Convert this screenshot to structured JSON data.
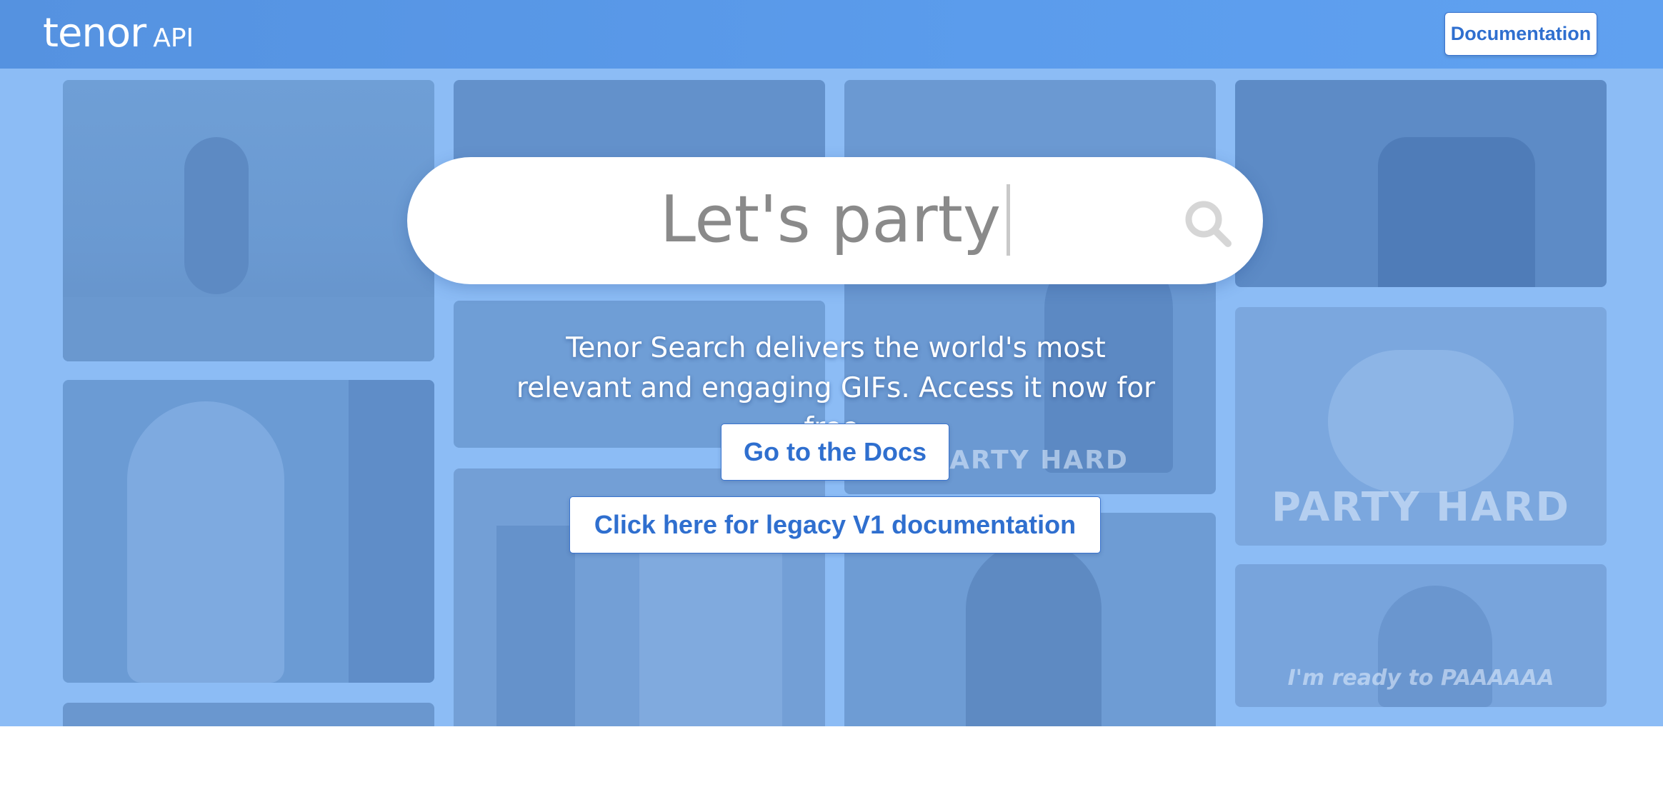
{
  "header": {
    "logo_word": "tenor",
    "logo_api": "API",
    "documentation_label": "Documentation"
  },
  "search": {
    "value": "Let's party"
  },
  "tagline": "Tenor Search delivers the world's most relevant and engaging GIFs. Access it now for free.",
  "buttons": {
    "docs_label": "Go to the Docs",
    "legacy_label": "Click here for legacy V1 documentation"
  },
  "gif_captions": {
    "party_hard_1": "PARTY HARD",
    "party_hard_2": "PARTY HARD",
    "ready": "I'm ready to PAAAAAA"
  },
  "colors": {
    "header": "#5b9cec",
    "hero_overlay": "#8cbcf5",
    "accent": "#2f6fcf"
  }
}
